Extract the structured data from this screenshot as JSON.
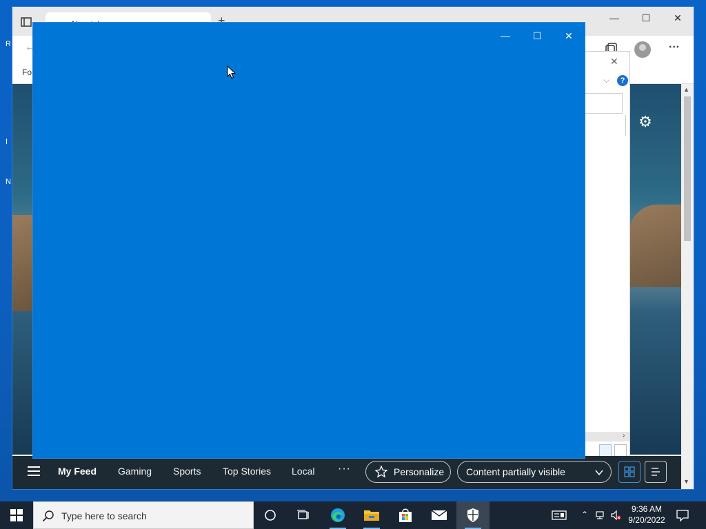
{
  "browser": {
    "tab_title": "New tab",
    "new_tab_glyph": "+",
    "favorites_label": "Fo",
    "window_controls": {
      "minimize": "—",
      "maximize": "☐",
      "close": "✕"
    },
    "toolbar_icons": [
      "collections-icon",
      "profile-icon",
      "more-icon"
    ]
  },
  "overlay_window": {
    "background": "#0077d6",
    "controls": {
      "minimize": "—",
      "maximize": "☐",
      "close": "✕"
    }
  },
  "side_dialog": {
    "close": "✕",
    "chevron": "⌵",
    "help": "?",
    "scroll_arrow": "›"
  },
  "feed_bar": {
    "nav": [
      "My Feed",
      "Gaming",
      "Sports",
      "Top Stories",
      "Local"
    ],
    "active": "My Feed",
    "more": "···",
    "personalize_label": "Personalize",
    "content_filter": "Content partially visible"
  },
  "taskbar": {
    "search_placeholder": "Type here to search",
    "time": "9:36 AM",
    "date": "9/20/2022",
    "apps": [
      "cortana-icon",
      "task-view-icon",
      "edge-icon",
      "file-explorer-icon",
      "store-icon",
      "mail-icon",
      "security-icon"
    ]
  },
  "colors": {
    "desktop": "#0a5fbf",
    "overlay": "#0077d6",
    "feedbar": "#1e2a33",
    "taskbar": "#1a2533"
  }
}
